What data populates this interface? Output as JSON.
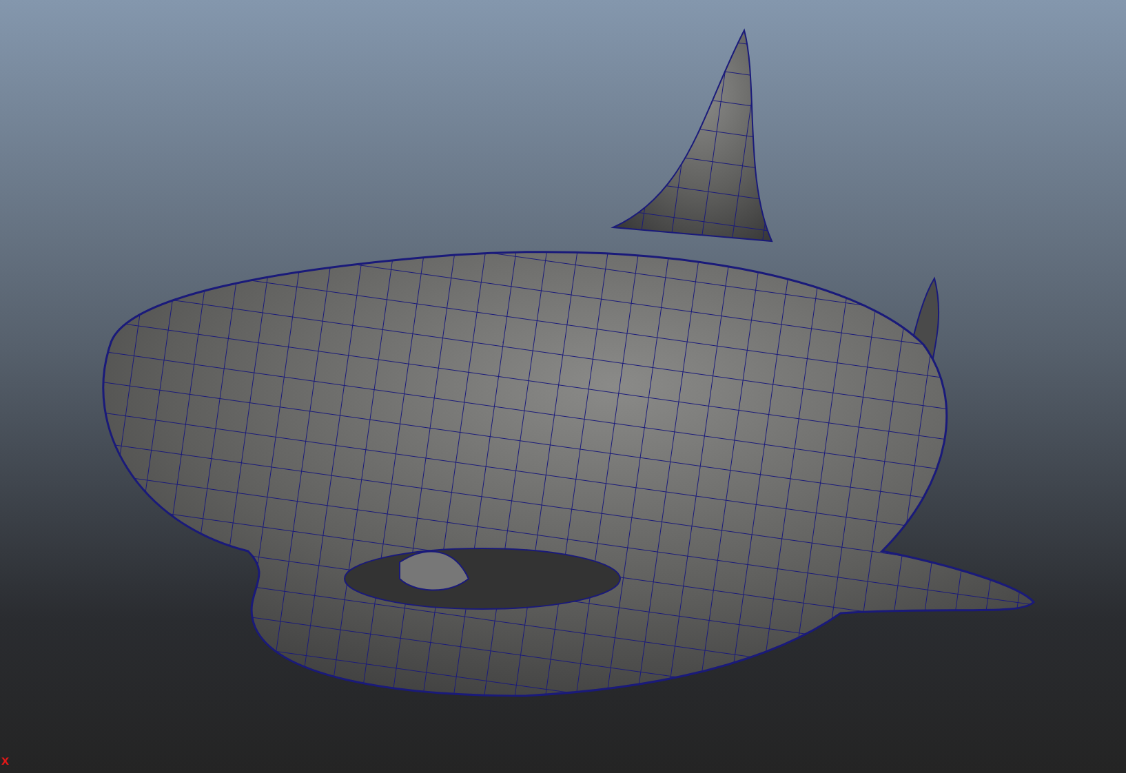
{
  "viewport": {
    "axis_label": "x"
  }
}
